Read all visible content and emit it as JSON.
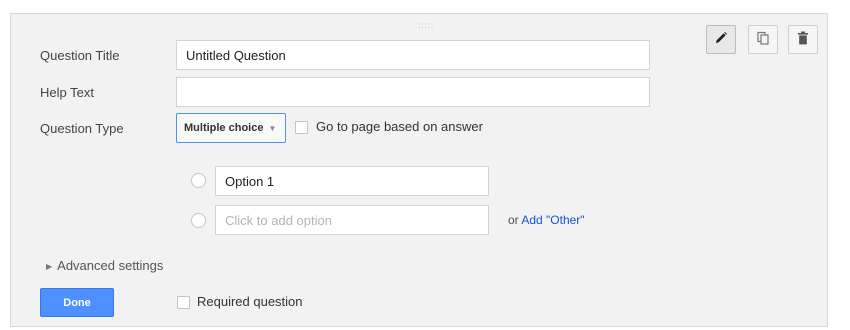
{
  "drag_handle": ":::::",
  "toolbar": {
    "edit_icon": "pencil-icon",
    "duplicate_icon": "duplicate-icon",
    "delete_icon": "trash-icon"
  },
  "fields": {
    "title_label": "Question Title",
    "title_value": "Untitled Question",
    "help_label": "Help Text",
    "help_value": "",
    "type_label": "Question Type",
    "type_value": "Multiple choice",
    "go_to_page_label": "Go to page based on answer"
  },
  "options": {
    "option_1_value": "Option 1",
    "add_option_placeholder": "Click to add option",
    "or_text": "or",
    "add_other_link": "Add \"Other\""
  },
  "advanced_settings": "Advanced settings",
  "footer": {
    "done_label": "Done",
    "required_label": "Required question"
  },
  "colors": {
    "primary_button": "#4d90fe",
    "link": "#1155cc",
    "card_background": "#f2f2f2"
  }
}
